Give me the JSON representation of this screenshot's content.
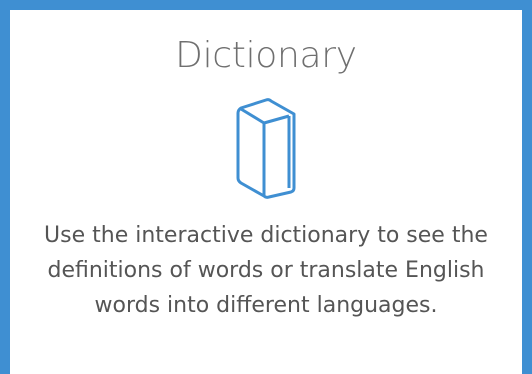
{
  "card": {
    "title": "Dictionary",
    "icon": "book-icon",
    "description": "Use the interactive dictionary to see the definitions of words or translate English words into different languages."
  },
  "colors": {
    "accent": "#3f8fd2",
    "title_text": "#6f6f6f",
    "body_text": "#555555"
  }
}
